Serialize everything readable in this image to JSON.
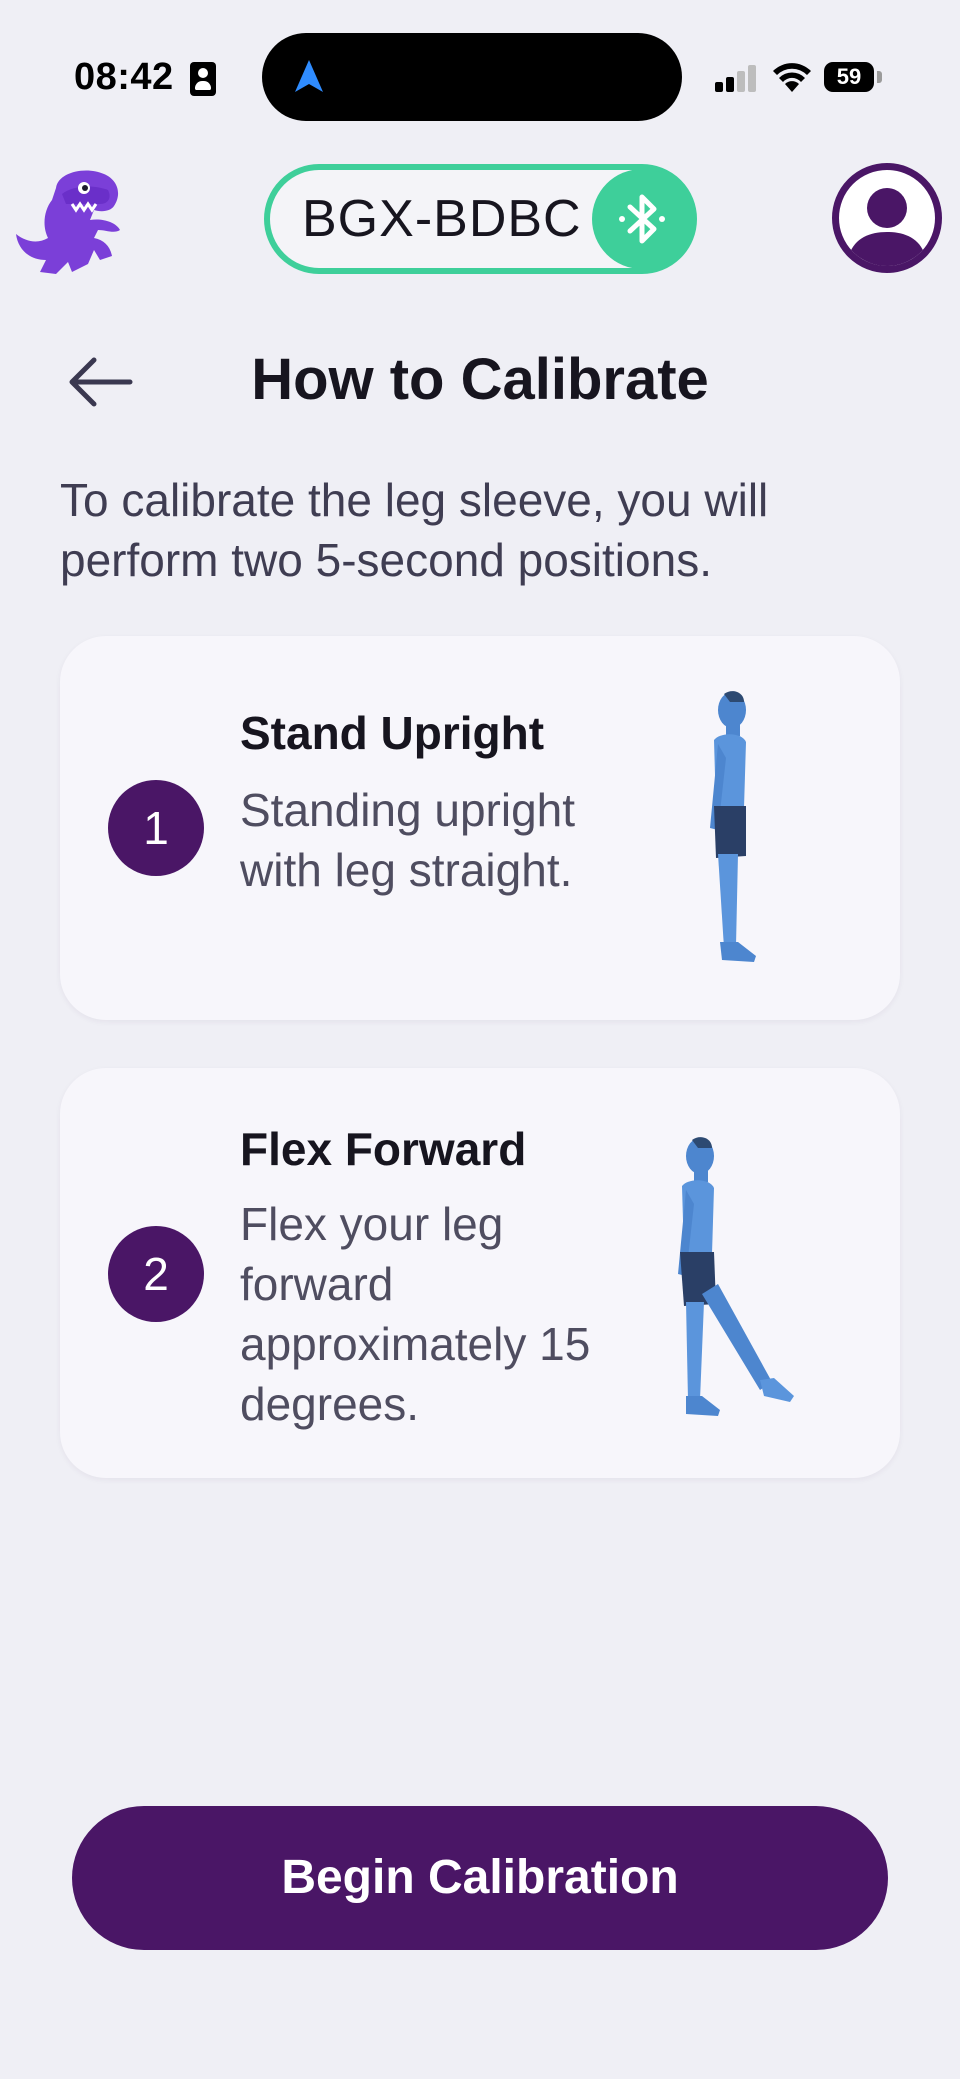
{
  "status_bar": {
    "time": "08:42",
    "battery": "59"
  },
  "header": {
    "device_name": "BGX-BDBC",
    "logo_icon": "dinosaur-logo-icon",
    "connection_icon": "bluetooth-icon",
    "profile_icon": "user-avatar-icon",
    "accent_color": "#3ecf9a",
    "brand_color": "#4a1666"
  },
  "page": {
    "title": "How to Calibrate",
    "back_icon": "arrow-left-icon",
    "intro": "To calibrate the leg sleeve, you will perform two 5-second positions."
  },
  "steps": [
    {
      "number": "1",
      "title": "Stand Upright",
      "description": "Standing upright with leg straight.",
      "figure": "standing-figure-icon"
    },
    {
      "number": "2",
      "title": "Flex Forward",
      "description": "Flex your leg forward approximately 15 degrees.",
      "figure": "flexing-figure-icon"
    }
  ],
  "actions": {
    "begin_label": "Begin Calibration"
  }
}
